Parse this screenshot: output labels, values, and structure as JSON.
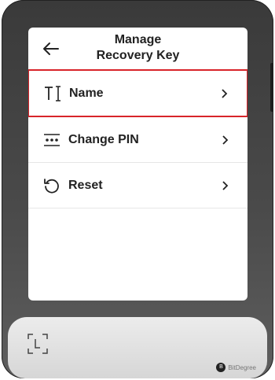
{
  "screen": {
    "title_line1": "Manage",
    "title_line2": "Recovery Key",
    "back_icon": "arrow-left-icon"
  },
  "menu": {
    "items": [
      {
        "label": "Name",
        "icon": "rename-text-cursor-icon",
        "selected": true
      },
      {
        "label": "Change PIN",
        "icon": "pin-dots-icon",
        "selected": false
      },
      {
        "label": "Reset",
        "icon": "reset-arrow-icon",
        "selected": false
      }
    ]
  },
  "colors": {
    "highlight": "#d8242a",
    "device_body": "#3a3a3a",
    "screen_bg": "#ffffff"
  },
  "watermark": {
    "text": "BitDegree"
  }
}
